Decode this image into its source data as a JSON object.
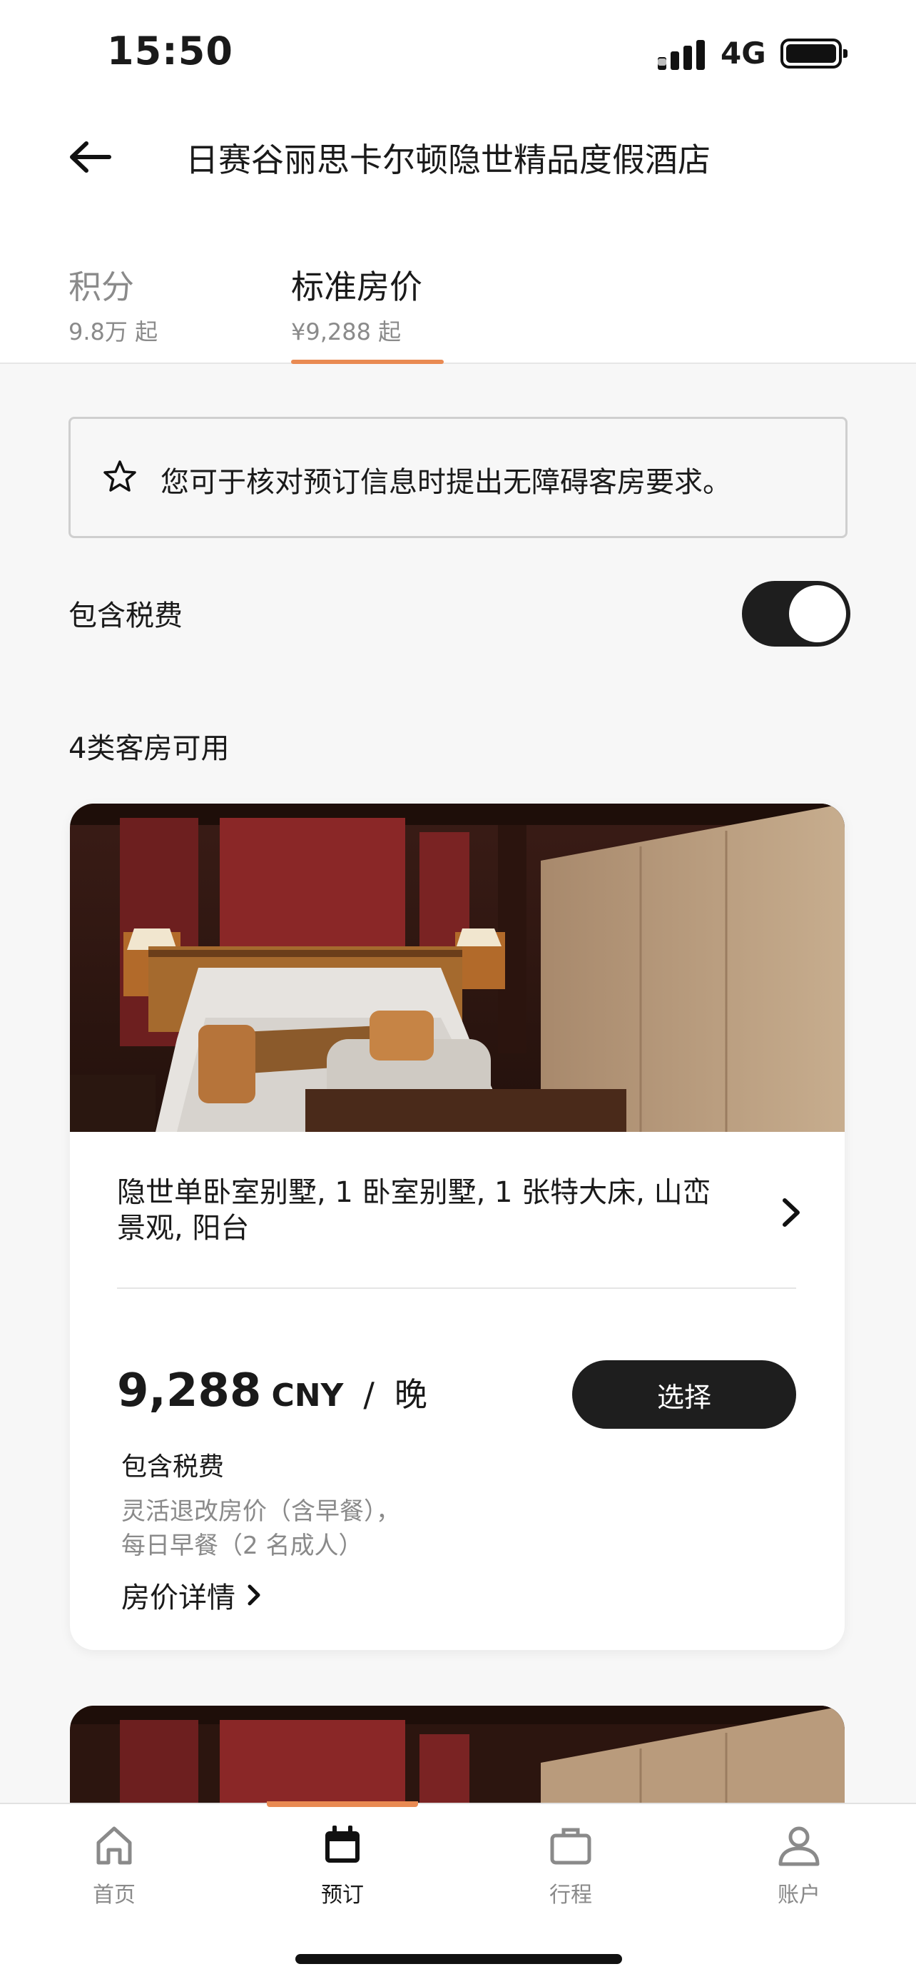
{
  "status_bar": {
    "time": "15:50",
    "network": "4G"
  },
  "header": {
    "title": "日赛谷丽思卡尔顿隐世精品度假酒店"
  },
  "tabs": [
    {
      "label": "积分",
      "sub": "9.8万 起",
      "active": false
    },
    {
      "label": "标准房价",
      "sub": "¥9,288 起",
      "active": true
    }
  ],
  "notice": {
    "text": "您可于核对预订信息时提出无障碍客房要求。"
  },
  "tax_toggle": {
    "label": "包含税费",
    "on": true
  },
  "rooms_count_label": "4类客房可用",
  "room_card": {
    "name": "隐世单卧室别墅, 1 卧室别墅, 1 张特大床, 山峦景观, 阳台",
    "price": "9,288",
    "currency": "CNY",
    "slash": "/",
    "per": "晚",
    "select_label": "选择",
    "tax_note": "包含税费",
    "rate_line1": "灵活退改房价（含早餐），",
    "rate_line2": "每日早餐（2 名成人）",
    "details_label": "房价详情"
  },
  "bottom_nav": [
    {
      "label": "首页",
      "icon": "home-icon",
      "active": false
    },
    {
      "label": "预订",
      "icon": "calendar-icon",
      "active": true
    },
    {
      "label": "行程",
      "icon": "briefcase-icon",
      "active": false
    },
    {
      "label": "账户",
      "icon": "user-icon",
      "active": false
    }
  ],
  "colors": {
    "accent": "#e98a52",
    "dark": "#1e1e1e",
    "muted": "#8a8a8a"
  }
}
